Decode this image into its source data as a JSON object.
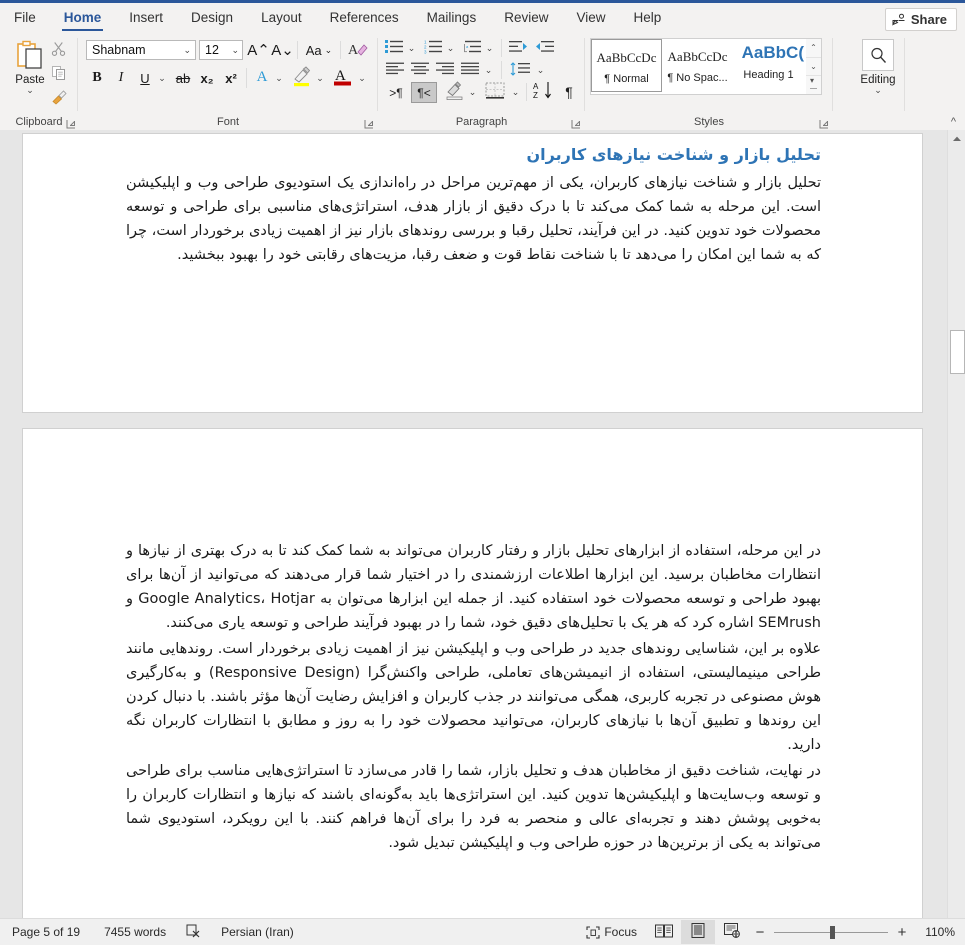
{
  "window": {
    "accent_color": "#2b579a",
    "ribbon_bg": "#f3f2f1"
  },
  "tabs": [
    {
      "label": "File",
      "active": false
    },
    {
      "label": "Home",
      "active": true
    },
    {
      "label": "Insert",
      "active": false
    },
    {
      "label": "Design",
      "active": false
    },
    {
      "label": "Layout",
      "active": false
    },
    {
      "label": "References",
      "active": false
    },
    {
      "label": "Mailings",
      "active": false
    },
    {
      "label": "Review",
      "active": false
    },
    {
      "label": "View",
      "active": false
    },
    {
      "label": "Help",
      "active": false
    }
  ],
  "share": {
    "label": "Share",
    "icon": "share-person-icon"
  },
  "ribbon": {
    "clipboard": {
      "group_label": "Clipboard",
      "paste_label": "Paste",
      "paste_chevron": "⌄",
      "cut_icon": "scissors-icon",
      "copy_icon": "copy-icon",
      "format_painter_icon": "format-painter-icon",
      "dialog_launcher": "dialog-launcher-icon"
    },
    "font": {
      "group_label": "Font",
      "font_name": "Shabnam",
      "font_size": "12",
      "grow_font": "A⌃",
      "shrink_font": "A⌄",
      "change_case": "Aa",
      "clear_formatting": "clear-formatting-icon",
      "bold": "B",
      "italic": "I",
      "underline": "U",
      "strikethrough": "ab",
      "subscript": "x₂",
      "superscript": "x²",
      "text_effects": "A",
      "highlight": "A",
      "font_color": "A",
      "highlight_color": "#ffff00",
      "font_color_swatch": "#c00000",
      "dialog_launcher": "dialog-launcher-icon"
    },
    "paragraph": {
      "group_label": "Paragraph",
      "bullets": "bullets-icon",
      "numbering": "numbering-icon",
      "multilevel": "multilevel-list-icon",
      "decrease_indent": "decrease-indent-icon",
      "increase_indent": "increase-indent-icon",
      "align_left": "align-left-icon",
      "align_center": "align-center-icon",
      "align_right": "align-right-icon",
      "justify": "justify-icon",
      "line_spacing": "line-spacing-icon",
      "ltr_text_direction": "ltr-text-direction-icon",
      "rtl_text_direction": "rtl-text-direction-icon",
      "rtl_active": true,
      "shading": "shading-icon",
      "borders": "borders-icon",
      "sort": "sort-icon",
      "show_marks": "¶",
      "dialog_launcher": "dialog-launcher-icon"
    },
    "styles": {
      "group_label": "Styles",
      "items": [
        {
          "preview": "AaBbCcDc",
          "name": "¶ Normal",
          "selected": true
        },
        {
          "preview": "AaBbCcDc",
          "name": "¶ No Spac...",
          "selected": false
        },
        {
          "preview": "AaBbC(",
          "name": "Heading 1",
          "selected": false,
          "heading": true
        }
      ],
      "scroll_up": "⌃",
      "scroll_down": "⌄",
      "more": "⌄",
      "dialog_launcher": "dialog-launcher-icon"
    },
    "editing": {
      "group_label": "",
      "label": "Editing",
      "icon": "search-icon",
      "chevron": "⌄"
    },
    "collapse_ribbon": "^"
  },
  "document": {
    "page1": {
      "heading": "تحلیل بازار و شناخت نیازهای کاربران",
      "paragraph": "تحلیل بازار و شناخت نیازهای کاربران، یکی از مهم‌ترین مراحل در راه‌اندازی یک استودیوی طراحی وب و اپلیکیشن است. این مرحله به شما کمک می‌کند تا با درک دقیق از بازار هدف، استراتژی‌های مناسبی برای طراحی و توسعه محصولات خود تدوین کنید. در این فرآیند، تحلیل رقبا و بررسی روندهای بازار نیز از اهمیت زیادی برخوردار است، چرا که به شما این امکان را می‌دهد تا با شناخت نقاط قوت و ضعف رقبا، مزیت‌های رقابتی خود را بهبود ببخشید."
    },
    "page2": {
      "paragraphs": [
        "در این مرحله، استفاده از ابزارهای تحلیل بازار و رفتار کاربران می‌تواند به شما کمک کند تا به درک بهتری از نیازها و انتظارات مخاطبان برسید. این ابزارها اطلاعات ارزشمندی را در اختیار شما قرار می‌دهند که می‌توانید از آن‌ها برای بهبود طراحی و توسعه محصولات خود استفاده کنید. از جمله این ابزارها می‌توان به Google Analytics، Hotjar و SEMrush اشاره کرد که هر یک با تحلیل‌های دقیق خود، شما را در بهبود فرآیند طراحی و توسعه یاری می‌کنند.",
        "علاوه بر این، شناسایی روندهای جدید در طراحی وب و اپلیکیشن نیز از اهمیت زیادی برخوردار است. روندهایی مانند طراحی مینیمالیستی، استفاده از انیمیشن‌های تعاملی، طراحی واکنش‌گرا (Responsive Design) و به‌کارگیری هوش مصنوعی در تجربه کاربری، همگی می‌توانند در جذب کاربران و افزایش رضایت آن‌ها مؤثر باشند. با دنبال کردن این روندها و تطبیق آن‌ها با نیازهای کاربران، می‌توانید محصولات خود را به روز و مطابق با انتظارات کاربران نگه دارید.",
        "در نهایت، شناخت دقیق از مخاطبان هدف و تحلیل بازار، شما را قادر می‌سازد تا استراتژی‌هایی مناسب برای طراحی و توسعه وب‌سایت‌ها و اپلیکیشن‌ها تدوین کنید. این استراتژی‌ها باید به‌گونه‌ای باشند که نیازها و انتظارات کاربران را به‌خوبی پوشش دهند و تجربه‌ای عالی و منحصر به فرد را برای آن‌ها فراهم کنند. با این رویکرد، استودیوی شما می‌تواند به یکی از برترین‌ها در حوزه طراحی وب و اپلیکیشن تبدیل شود."
      ]
    },
    "heading_color": "#2e74b5"
  },
  "scrollbar": {
    "up_arrow": "▲",
    "down_arrow": "▼"
  },
  "status_bar": {
    "page": "Page 5 of 19",
    "words": "7455 words",
    "proofing_icon": "proofing-errors-icon",
    "language": "Persian (Iran)",
    "focus": "Focus",
    "focus_icon": "focus-icon",
    "read_mode_icon": "read-mode-icon",
    "print_layout_icon": "print-layout-icon",
    "web_layout_icon": "web-layout-icon",
    "active_view": "print-layout",
    "zoom_out": "−",
    "zoom_in": "+",
    "zoom_value": "110%"
  }
}
